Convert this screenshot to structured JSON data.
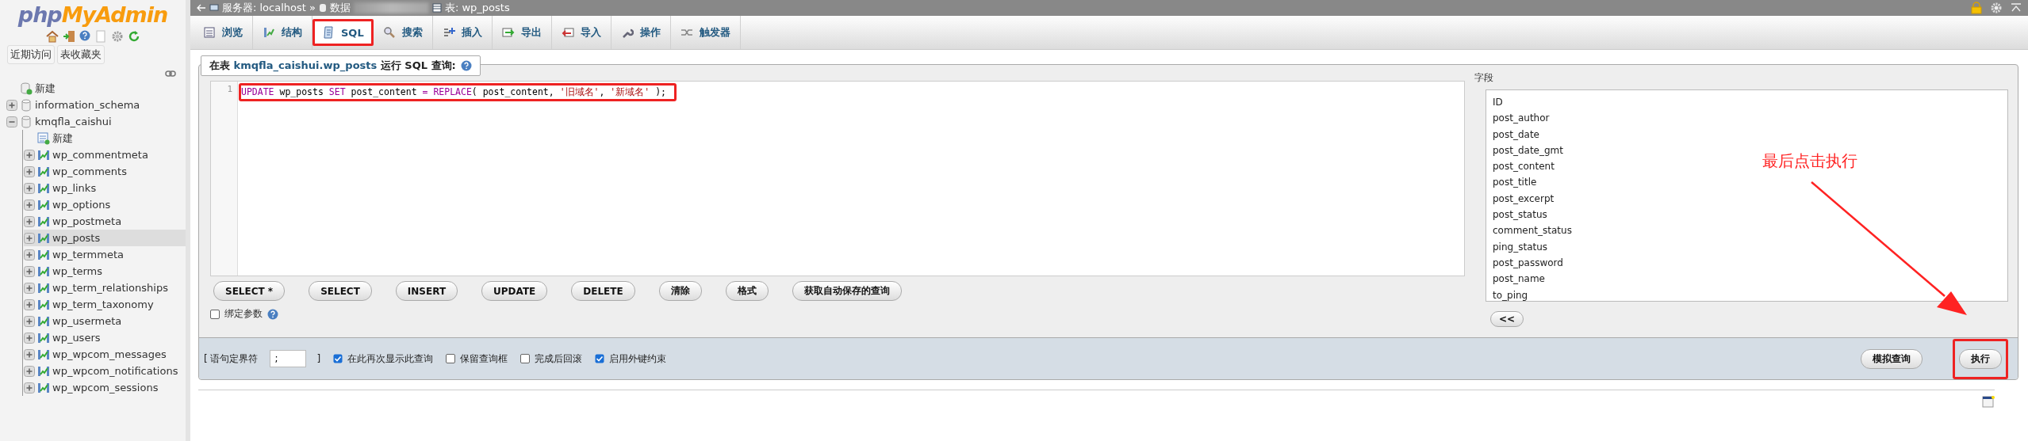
{
  "breadcrumb": {
    "server": "服务器: localhost »",
    "database": "数据",
    "table": "表: wp_posts"
  },
  "sidebar": {
    "logo_php": "php",
    "logo_rest": "MyAdmin",
    "buttons": [
      "近期访问",
      "表收藏夹"
    ],
    "tree": [
      {
        "label": "新建",
        "kind": "new-db",
        "selected": false
      },
      {
        "label": "information_schema",
        "kind": "db",
        "expanded": false,
        "selected": false
      },
      {
        "label": "kmqfla_caishui",
        "kind": "db",
        "expanded": true,
        "selected": false,
        "children": [
          {
            "label": "新建",
            "kind": "new-table",
            "selected": false
          },
          {
            "label": "wp_commentmeta",
            "kind": "table",
            "expanded": false,
            "selected": false
          },
          {
            "label": "wp_comments",
            "kind": "table",
            "expanded": false,
            "selected": false
          },
          {
            "label": "wp_links",
            "kind": "table",
            "expanded": false,
            "selected": false
          },
          {
            "label": "wp_options",
            "kind": "table",
            "expanded": false,
            "selected": false
          },
          {
            "label": "wp_postmeta",
            "kind": "table",
            "expanded": false,
            "selected": false
          },
          {
            "label": "wp_posts",
            "kind": "table",
            "expanded": false,
            "selected": true
          },
          {
            "label": "wp_termmeta",
            "kind": "table",
            "expanded": false,
            "selected": false
          },
          {
            "label": "wp_terms",
            "kind": "table",
            "expanded": false,
            "selected": false
          },
          {
            "label": "wp_term_relationships",
            "kind": "table",
            "expanded": false,
            "selected": false
          },
          {
            "label": "wp_term_taxonomy",
            "kind": "table",
            "expanded": false,
            "selected": false
          },
          {
            "label": "wp_usermeta",
            "kind": "table",
            "expanded": false,
            "selected": false
          },
          {
            "label": "wp_users",
            "kind": "table",
            "expanded": false,
            "selected": false
          },
          {
            "label": "wp_wpcom_messages",
            "kind": "table",
            "expanded": false,
            "selected": false
          },
          {
            "label": "wp_wpcom_notifications",
            "kind": "table",
            "expanded": false,
            "selected": false
          },
          {
            "label": "wp_wpcom_sessions",
            "kind": "table",
            "expanded": false,
            "selected": false
          }
        ]
      }
    ]
  },
  "tabs": [
    {
      "label": "浏览",
      "selected": false,
      "highlighted": false
    },
    {
      "label": "结构",
      "selected": false,
      "highlighted": false
    },
    {
      "label": "SQL",
      "selected": true,
      "highlighted": true
    },
    {
      "label": "搜索",
      "selected": false,
      "highlighted": false
    },
    {
      "label": "插入",
      "selected": false,
      "highlighted": false
    },
    {
      "label": "导出",
      "selected": false,
      "highlighted": false
    },
    {
      "label": "导入",
      "selected": false,
      "highlighted": false
    },
    {
      "label": "操作",
      "selected": false,
      "highlighted": false
    },
    {
      "label": "触发器",
      "selected": false,
      "highlighted": false
    }
  ],
  "query": {
    "legend": {
      "before": "在表 ",
      "link": "kmqfla_caishui.wp_posts",
      "after": " 运行 SQL 查询:"
    },
    "line_numbers": [
      "1"
    ],
    "highlighted": true,
    "tokens": [
      {
        "kind": "keyword",
        "text": "UPDATE"
      },
      {
        "kind": "plain",
        "text": " wp_posts "
      },
      {
        "kind": "keyword",
        "text": "SET"
      },
      {
        "kind": "plain",
        "text": " post_content "
      },
      {
        "kind": "operator",
        "text": "= "
      },
      {
        "kind": "keyword",
        "text": "REPLACE"
      },
      {
        "kind": "plain",
        "text": "( post_content, "
      },
      {
        "kind": "string",
        "text": "'旧域名'"
      },
      {
        "kind": "plain",
        "text": ", "
      },
      {
        "kind": "string",
        "text": "'新域名'"
      },
      {
        "kind": "plain",
        "text": " );"
      }
    ],
    "buttons": [
      "SELECT *",
      "SELECT",
      "INSERT",
      "UPDATE",
      "DELETE",
      "清除",
      "格式",
      "获取自动保存的查询"
    ],
    "bind_params": {
      "label": "绑定参数",
      "checked": false
    }
  },
  "fields": {
    "title": "字段",
    "items": [
      "ID",
      "post_author",
      "post_date",
      "post_date_gmt",
      "post_content",
      "post_title",
      "post_excerpt",
      "post_status",
      "comment_status",
      "ping_status",
      "post_password",
      "post_name",
      "to_ping"
    ],
    "insert_button": "<<"
  },
  "bottom_bar": {
    "delimiter_open": "[ 语句定界符",
    "delimiter_value": ";",
    "delimiter_close": "]",
    "options": [
      {
        "label": "在此再次显示此查询",
        "checked": true
      },
      {
        "label": "保留查询框",
        "checked": false
      },
      {
        "label": "完成后回滚",
        "checked": false
      },
      {
        "label": "启用外键约束",
        "checked": true
      }
    ],
    "buttons": [
      {
        "label": "模拟查询",
        "highlighted": false
      },
      {
        "label": "执行",
        "highlighted": true
      }
    ]
  },
  "annotation": {
    "note": "最后点击执行"
  }
}
